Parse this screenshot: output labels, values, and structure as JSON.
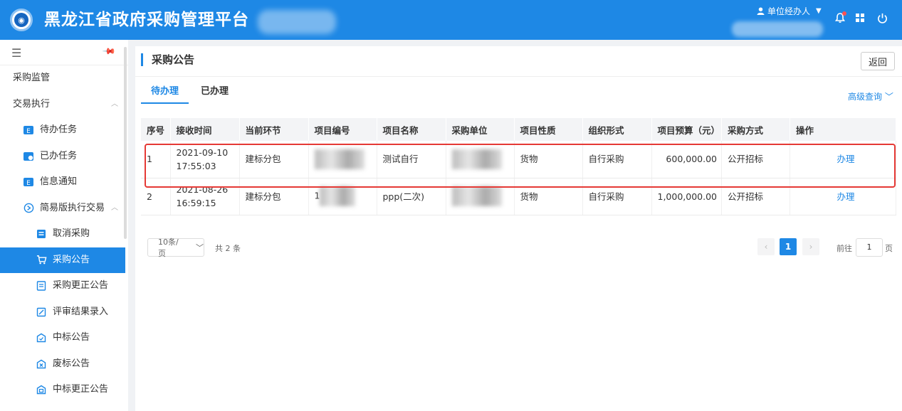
{
  "app": {
    "title": "黑龙江省政府采购管理平台",
    "logo_icon": "emblem-icon"
  },
  "header": {
    "user_label": "单位经办人",
    "icons": [
      "bell-icon",
      "grid-icon",
      "power-icon"
    ]
  },
  "sidebar": {
    "items": [
      {
        "label": "采购监管",
        "level": 1
      },
      {
        "label": "交易执行",
        "level": 1,
        "expanded": true
      },
      {
        "label": "待办任务",
        "level": 2,
        "icon": "todo-icon"
      },
      {
        "label": "已办任务",
        "level": 2,
        "icon": "done-icon"
      },
      {
        "label": "信息通知",
        "level": 2,
        "icon": "notice-icon"
      },
      {
        "label": "简易版执行交易",
        "level": 2,
        "icon": "trade-icon",
        "expanded": true
      },
      {
        "label": "取消采购",
        "level": 3,
        "icon": "cancel-doc-icon"
      },
      {
        "label": "采购公告",
        "level": 3,
        "icon": "cart-icon",
        "active": true
      },
      {
        "label": "采购更正公告",
        "level": 3,
        "icon": "correction-doc-icon"
      },
      {
        "label": "评审结果录入",
        "level": 3,
        "icon": "edit-doc-icon"
      },
      {
        "label": "中标公告",
        "level": 3,
        "icon": "award-doc-icon"
      },
      {
        "label": "废标公告",
        "level": 3,
        "icon": "void-doc-icon"
      },
      {
        "label": "中标更正公告",
        "level": 3,
        "icon": "award-correction-icon"
      }
    ]
  },
  "main": {
    "page_title": "采购公告",
    "back_label": "返回",
    "tabs": [
      {
        "label": "待办理",
        "active": true
      },
      {
        "label": "已办理",
        "active": false
      }
    ],
    "advanced_search": "高级查询",
    "table": {
      "columns": [
        "序号",
        "接收时间",
        "当前环节",
        "项目编号",
        "项目名称",
        "采购单位",
        "项目性质",
        "组织形式",
        "项目预算（元）",
        "采购方式",
        "操作"
      ],
      "rows": [
        {
          "index": "1",
          "time": "2021-09-10 17:55:03",
          "stage": "建标分包",
          "project_no": "",
          "project_name": "测试自行",
          "purchaser": "",
          "nature": "货物",
          "org_form": "自行采购",
          "budget": "600,000.00",
          "method": "公开招标",
          "action": "办理",
          "highlighted": true
        },
        {
          "index": "2",
          "time": "2021-08-26 16:59:15",
          "stage": "建标分包",
          "project_no": "1",
          "project_name": "ppp(二次)",
          "purchaser": "",
          "nature": "货物",
          "org_form": "自行采购",
          "budget": "1,000,000.00",
          "method": "公开招标",
          "action": "办理",
          "highlighted": false
        }
      ]
    },
    "pagination": {
      "page_size": "10条/页",
      "total": "共 2 条",
      "current": "1",
      "goto_prefix": "前往",
      "goto_value": "1",
      "goto_suffix": "页"
    }
  },
  "colors": {
    "primary": "#1e88e5",
    "highlight_border": "#e53935"
  }
}
